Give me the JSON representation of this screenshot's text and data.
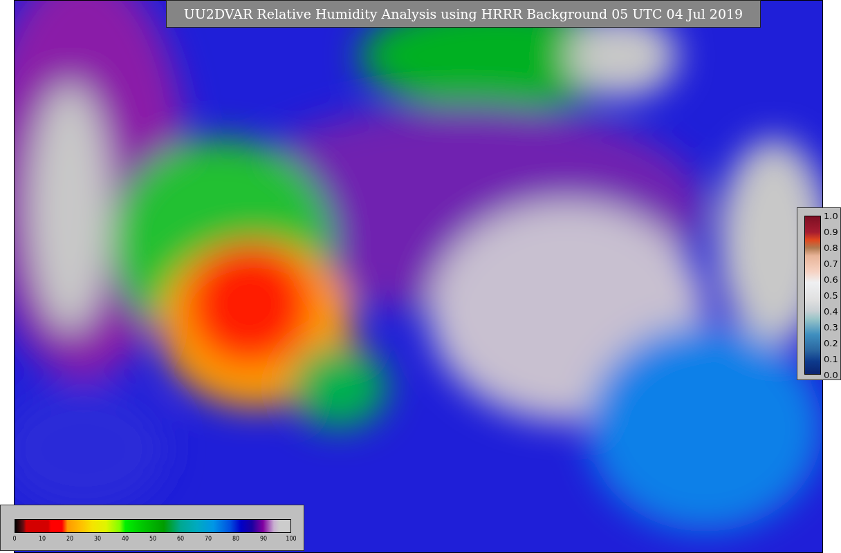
{
  "title": "UU2DVAR Relative Humidity Analysis using HRRR Background 05 UTC 04 Jul 2019",
  "humidity_colorbar": {
    "tick_labels": [
      "0",
      "10",
      "20",
      "30",
      "40",
      "50",
      "60",
      "70",
      "80",
      "90",
      "100"
    ]
  },
  "observation_colorbar": {
    "tick_labels": [
      "1.0",
      "0.9",
      "0.8",
      "0.7",
      "0.6",
      "0.5",
      "0.4",
      "0.3",
      "0.2",
      "0.1",
      "0.0"
    ]
  }
}
